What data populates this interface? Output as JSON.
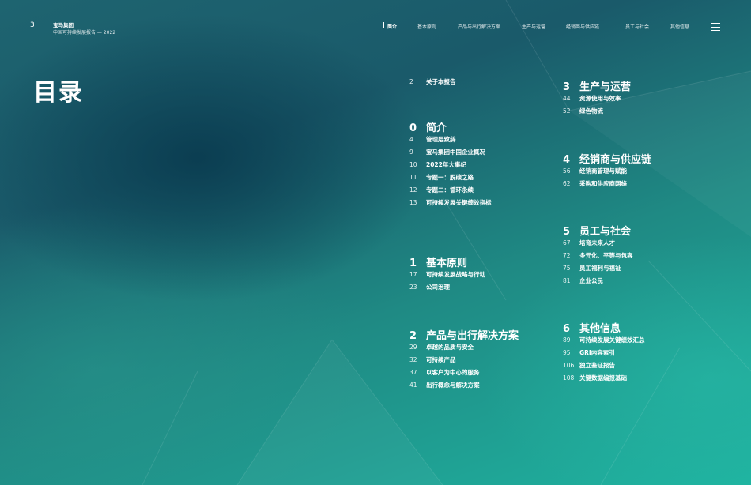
{
  "header": {
    "page_number": "3",
    "company": "宝马集团",
    "report": "中国可持续发展报告 — 2022",
    "nav": [
      {
        "label": "简介",
        "active": true
      },
      {
        "label": "基本原则"
      },
      {
        "label": "产品与出行解决方案"
      },
      {
        "label": "生产与运营"
      },
      {
        "label": "经销商与供应链"
      },
      {
        "label": "员工与社会"
      },
      {
        "label": "其他信息"
      }
    ],
    "menu_icon": "hamburger-icon"
  },
  "title": "目录",
  "toc": {
    "about": {
      "page": "2",
      "title": "关于本报告"
    },
    "sections": [
      {
        "num": "0",
        "title": "简介",
        "entries": [
          {
            "page": "4",
            "title": "管理层致辞"
          },
          {
            "page": "9",
            "title": "宝马集团中国企业概况"
          },
          {
            "page": "10",
            "title": "2022年大事纪"
          },
          {
            "page": "11",
            "title": "专题一：脱碳之路"
          },
          {
            "page": "12",
            "title": "专题二：循环永续"
          },
          {
            "page": "13",
            "title": "可持续发展关键绩效指标"
          }
        ]
      },
      {
        "num": "1",
        "title": "基本原则",
        "entries": [
          {
            "page": "17",
            "title": "可持续发展战略与行动"
          },
          {
            "page": "23",
            "title": "公司治理"
          }
        ]
      },
      {
        "num": "2",
        "title": "产品与出行解决方案",
        "entries": [
          {
            "page": "29",
            "title": "卓越的品质与安全"
          },
          {
            "page": "32",
            "title": "可持续产品"
          },
          {
            "page": "37",
            "title": "以客户为中心的服务"
          },
          {
            "page": "41",
            "title": "出行概念与解决方案"
          }
        ]
      },
      {
        "num": "3",
        "title": "生产与运营",
        "entries": [
          {
            "page": "44",
            "title": "资源使用与效率"
          },
          {
            "page": "52",
            "title": "绿色物流"
          }
        ]
      },
      {
        "num": "4",
        "title": "经销商与供应链",
        "entries": [
          {
            "page": "56",
            "title": "经销商管理与赋能"
          },
          {
            "page": "62",
            "title": "采购和供应商网络"
          }
        ]
      },
      {
        "num": "5",
        "title": "员工与社会",
        "entries": [
          {
            "page": "67",
            "title": "培育未来人才"
          },
          {
            "page": "72",
            "title": "多元化、平等与包容"
          },
          {
            "page": "75",
            "title": "员工福利与福祉"
          },
          {
            "page": "81",
            "title": "企业公民"
          }
        ]
      },
      {
        "num": "6",
        "title": "其他信息",
        "entries": [
          {
            "page": "89",
            "title": "可持续发展关键绩效汇总"
          },
          {
            "page": "95",
            "title": "GRI内容索引"
          },
          {
            "page": "106",
            "title": "独立鉴证报告"
          },
          {
            "page": "108",
            "title": "关键数据编报基础"
          }
        ]
      }
    ]
  }
}
